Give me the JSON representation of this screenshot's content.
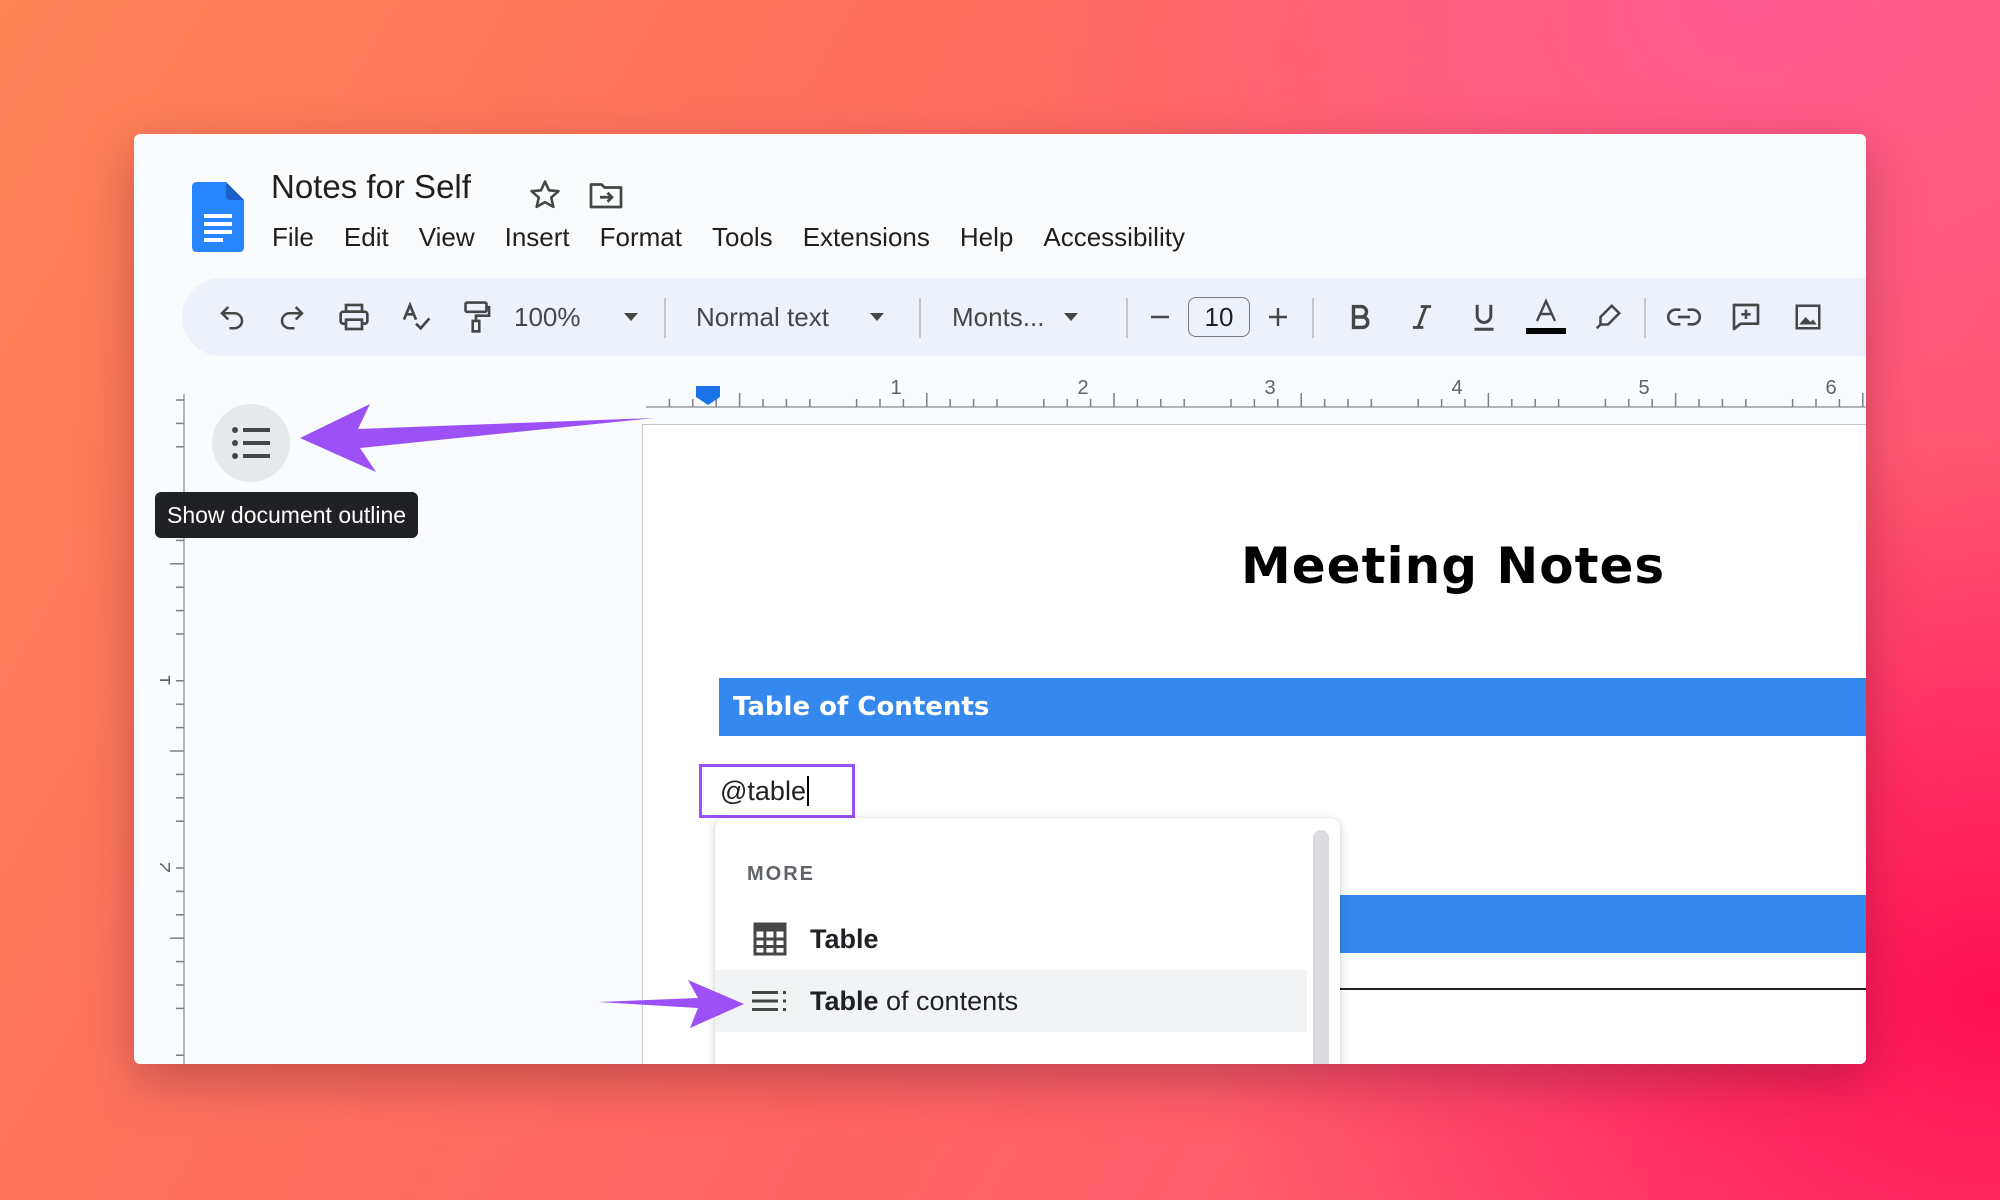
{
  "document": {
    "title": "Notes for Self"
  },
  "menu": [
    "File",
    "Edit",
    "View",
    "Insert",
    "Format",
    "Tools",
    "Extensions",
    "Help",
    "Accessibility"
  ],
  "toolbar": {
    "zoom": "100%",
    "style": "Normal text",
    "font": "Monts...",
    "font_size": "10"
  },
  "ruler": {
    "top_labels": [
      "1",
      "2",
      "3",
      "4",
      "5",
      "6"
    ],
    "left_labels": [
      "1",
      "2"
    ]
  },
  "sidebar": {
    "tooltip": "Show document outline"
  },
  "page": {
    "heading": "Meeting Notes",
    "toc_band": "Table of Contents",
    "typed_text": "@table"
  },
  "dropdown": {
    "section": "MORE",
    "items": [
      {
        "label": "Table",
        "label_rest": "",
        "icon": "table-grid-icon"
      },
      {
        "label": "Table",
        "label_rest": " of contents",
        "icon": "table-of-contents-icon"
      }
    ]
  },
  "colors": {
    "accent_blue": "#3488ee",
    "annotation_purple": "#9b51f5",
    "docs_blue": "#1a73e8"
  }
}
